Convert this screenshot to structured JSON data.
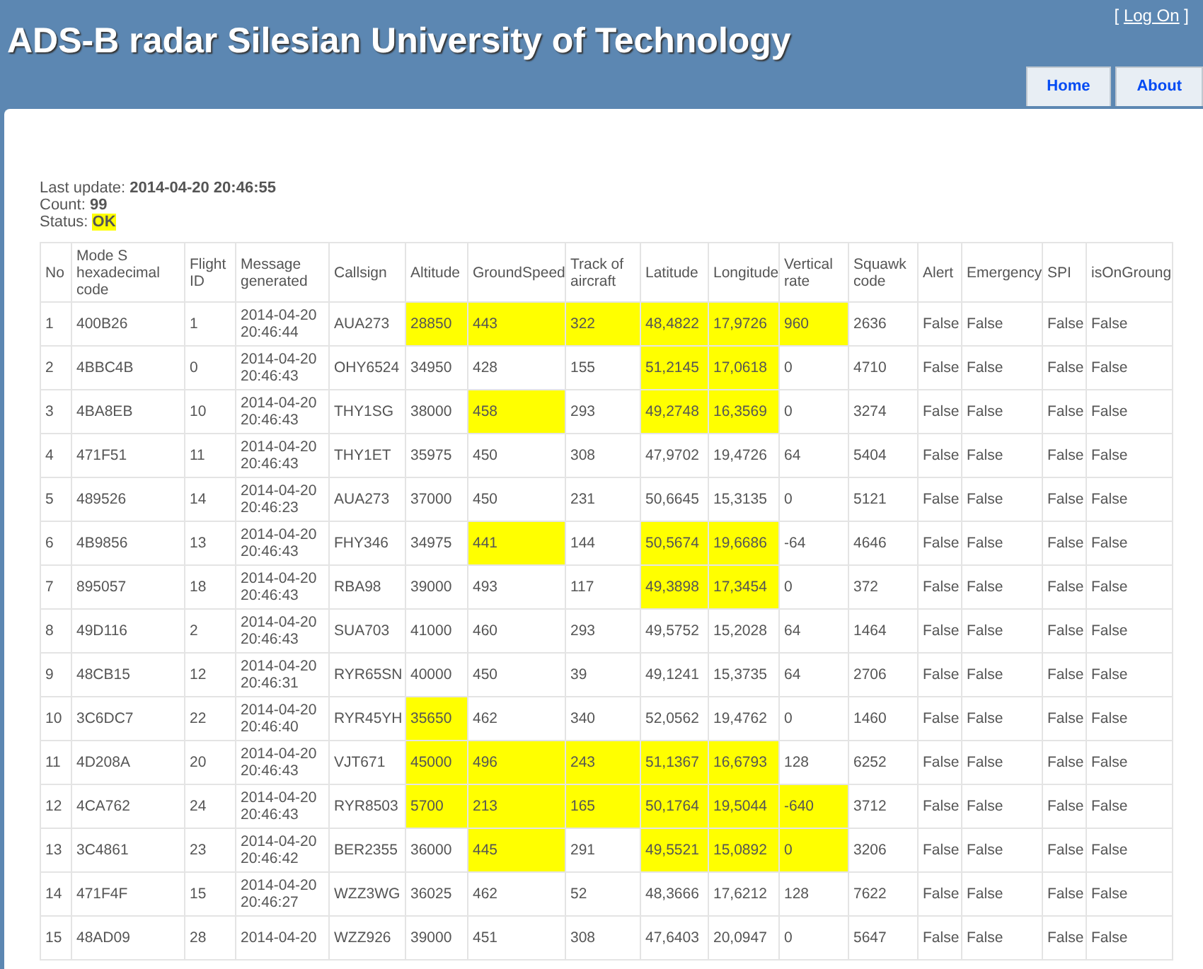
{
  "header": {
    "title": "ADS-B radar Silesian University of Technology",
    "login": {
      "before": "[ ",
      "link": "Log On",
      "after": " ]"
    }
  },
  "nav": [
    {
      "label": "Home"
    },
    {
      "label": "About"
    }
  ],
  "info": [
    {
      "label": "Last update:",
      "value": "2014-04-20 20:46:55",
      "highlighted": false
    },
    {
      "label": "Count:",
      "value": "99",
      "highlighted": false
    },
    {
      "label": "Status:",
      "value": "OK",
      "highlighted": true
    }
  ],
  "table": {
    "columns": [
      "No",
      "Mode S hexadecimal code",
      "Flight ID",
      "Message generated",
      "Callsign",
      "Altitude",
      "GroundSpeed",
      "Track of aircraft",
      "Latitude",
      "Longitude",
      "Vertical rate",
      "Squawk code",
      "Alert",
      "Emergency",
      "SPI",
      "isOnGroung"
    ],
    "rows": [
      {
        "values": [
          "1",
          "400B26",
          "1",
          "2014-04-20 20:46:44",
          "AUA273",
          "28850",
          "443",
          "322",
          "48,4822",
          "17,9726",
          "960",
          "2636",
          "False",
          "False",
          "False",
          "False"
        ],
        "highlighted": [
          false,
          false,
          false,
          false,
          false,
          true,
          true,
          true,
          true,
          true,
          true,
          false,
          false,
          false,
          false,
          false
        ]
      },
      {
        "values": [
          "2",
          "4BBC4B",
          "0",
          "2014-04-20 20:46:43",
          "OHY6524",
          "34950",
          "428",
          "155",
          "51,2145",
          "17,0618",
          "0",
          "4710",
          "False",
          "False",
          "False",
          "False"
        ],
        "highlighted": [
          false,
          false,
          false,
          false,
          false,
          false,
          false,
          false,
          true,
          true,
          false,
          false,
          false,
          false,
          false,
          false
        ]
      },
      {
        "values": [
          "3",
          "4BA8EB",
          "10",
          "2014-04-20 20:46:43",
          "THY1SG",
          "38000",
          "458",
          "293",
          "49,2748",
          "16,3569",
          "0",
          "3274",
          "False",
          "False",
          "False",
          "False"
        ],
        "highlighted": [
          false,
          false,
          false,
          false,
          false,
          false,
          true,
          false,
          true,
          true,
          false,
          false,
          false,
          false,
          false,
          false
        ]
      },
      {
        "values": [
          "4",
          "471F51",
          "11",
          "2014-04-20 20:46:43",
          "THY1ET",
          "35975",
          "450",
          "308",
          "47,9702",
          "19,4726",
          "64",
          "5404",
          "False",
          "False",
          "False",
          "False"
        ],
        "highlighted": [
          false,
          false,
          false,
          false,
          false,
          false,
          false,
          false,
          false,
          false,
          false,
          false,
          false,
          false,
          false,
          false
        ]
      },
      {
        "values": [
          "5",
          "489526",
          "14",
          "2014-04-20 20:46:23",
          "AUA273",
          "37000",
          "450",
          "231",
          "50,6645",
          "15,3135",
          "0",
          "5121",
          "False",
          "False",
          "False",
          "False"
        ],
        "highlighted": [
          false,
          false,
          false,
          false,
          false,
          false,
          false,
          false,
          false,
          false,
          false,
          false,
          false,
          false,
          false,
          false
        ]
      },
      {
        "values": [
          "6",
          "4B9856",
          "13",
          "2014-04-20 20:46:43",
          "FHY346",
          "34975",
          "441",
          "144",
          "50,5674",
          "19,6686",
          "-64",
          "4646",
          "False",
          "False",
          "False",
          "False"
        ],
        "highlighted": [
          false,
          false,
          false,
          false,
          false,
          false,
          true,
          false,
          true,
          true,
          false,
          false,
          false,
          false,
          false,
          false
        ]
      },
      {
        "values": [
          "7",
          "895057",
          "18",
          "2014-04-20 20:46:43",
          "RBA98",
          "39000",
          "493",
          "117",
          "49,3898",
          "17,3454",
          "0",
          "372",
          "False",
          "False",
          "False",
          "False"
        ],
        "highlighted": [
          false,
          false,
          false,
          false,
          false,
          false,
          false,
          false,
          true,
          true,
          false,
          false,
          false,
          false,
          false,
          false
        ]
      },
      {
        "values": [
          "8",
          "49D116",
          "2",
          "2014-04-20 20:46:43",
          "SUA703",
          "41000",
          "460",
          "293",
          "49,5752",
          "15,2028",
          "64",
          "1464",
          "False",
          "False",
          "False",
          "False"
        ],
        "highlighted": [
          false,
          false,
          false,
          false,
          false,
          false,
          false,
          false,
          false,
          false,
          false,
          false,
          false,
          false,
          false,
          false
        ]
      },
      {
        "values": [
          "9",
          "48CB15",
          "12",
          "2014-04-20 20:46:31",
          "RYR65SN",
          "40000",
          "450",
          "39",
          "49,1241",
          "15,3735",
          "64",
          "2706",
          "False",
          "False",
          "False",
          "False"
        ],
        "highlighted": [
          false,
          false,
          false,
          false,
          false,
          false,
          false,
          false,
          false,
          false,
          false,
          false,
          false,
          false,
          false,
          false
        ]
      },
      {
        "values": [
          "10",
          "3C6DC7",
          "22",
          "2014-04-20 20:46:40",
          "RYR45YH",
          "35650",
          "462",
          "340",
          "52,0562",
          "19,4762",
          "0",
          "1460",
          "False",
          "False",
          "False",
          "False"
        ],
        "highlighted": [
          false,
          false,
          false,
          false,
          false,
          true,
          false,
          false,
          false,
          false,
          false,
          false,
          false,
          false,
          false,
          false
        ]
      },
      {
        "values": [
          "11",
          "4D208A",
          "20",
          "2014-04-20 20:46:43",
          "VJT671",
          "45000",
          "496",
          "243",
          "51,1367",
          "16,6793",
          "128",
          "6252",
          "False",
          "False",
          "False",
          "False"
        ],
        "highlighted": [
          false,
          false,
          false,
          false,
          false,
          true,
          true,
          true,
          true,
          true,
          false,
          false,
          false,
          false,
          false,
          false
        ]
      },
      {
        "values": [
          "12",
          "4CA762",
          "24",
          "2014-04-20 20:46:43",
          "RYR8503",
          "5700",
          "213",
          "165",
          "50,1764",
          "19,5044",
          "-640",
          "3712",
          "False",
          "False",
          "False",
          "False"
        ],
        "highlighted": [
          false,
          false,
          false,
          false,
          false,
          true,
          true,
          true,
          true,
          true,
          true,
          false,
          false,
          false,
          false,
          false
        ]
      },
      {
        "values": [
          "13",
          "3C4861",
          "23",
          "2014-04-20 20:46:42",
          "BER2355",
          "36000",
          "445",
          "291",
          "49,5521",
          "15,0892",
          "0",
          "3206",
          "False",
          "False",
          "False",
          "False"
        ],
        "highlighted": [
          false,
          false,
          false,
          false,
          false,
          false,
          true,
          false,
          true,
          true,
          true,
          false,
          false,
          false,
          false,
          false
        ]
      },
      {
        "values": [
          "14",
          "471F4F",
          "15",
          "2014-04-20 20:46:27",
          "WZZ3WG",
          "36025",
          "462",
          "52",
          "48,3666",
          "17,6212",
          "128",
          "7622",
          "False",
          "False",
          "False",
          "False"
        ],
        "highlighted": [
          false,
          false,
          false,
          false,
          false,
          false,
          false,
          false,
          false,
          false,
          false,
          false,
          false,
          false,
          false,
          false
        ]
      },
      {
        "values": [
          "15",
          "48AD09",
          "28",
          "2014-04-20",
          "WZZ926",
          "39000",
          "451",
          "308",
          "47,6403",
          "20,0947",
          "0",
          "5647",
          "False",
          "False",
          "False",
          "False"
        ],
        "highlighted": [
          false,
          false,
          false,
          false,
          false,
          false,
          false,
          false,
          false,
          false,
          false,
          false,
          false,
          false,
          false,
          false
        ]
      }
    ]
  }
}
